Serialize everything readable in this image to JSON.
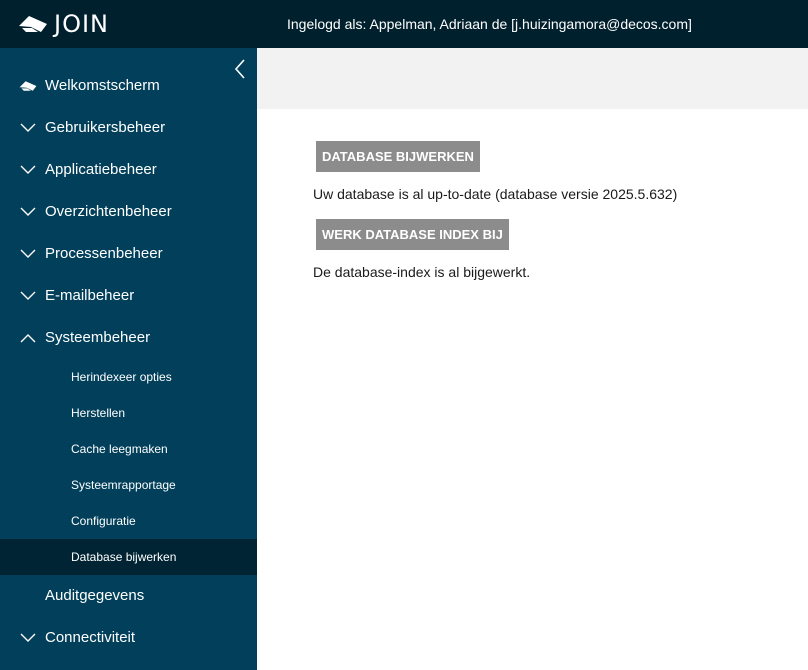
{
  "app": {
    "brand_name": "JOIN",
    "logged_in_text": "Ingelogd als: Appelman, Adriaan de [j.huizingamora@decos.com]"
  },
  "sidebar": {
    "items": [
      {
        "label": "Welkomstscherm",
        "icon": "join-logo-icon"
      },
      {
        "label": "Gebruikersbeheer",
        "icon": "chevron-down-icon"
      },
      {
        "label": "Applicatiebeheer",
        "icon": "chevron-down-icon"
      },
      {
        "label": "Overzichtenbeheer",
        "icon": "chevron-down-icon"
      },
      {
        "label": "Processenbeheer",
        "icon": "chevron-down-icon"
      },
      {
        "label": "E-mailbeheer",
        "icon": "chevron-down-icon"
      },
      {
        "label": "Systeembeheer",
        "icon": "chevron-up-icon",
        "expanded": true
      },
      {
        "label": "Auditgegevens"
      },
      {
        "label": "Connectiviteit",
        "icon": "chevron-down-icon"
      }
    ],
    "sub_items": [
      {
        "label": "Herindexeer opties"
      },
      {
        "label": "Herstellen"
      },
      {
        "label": "Cache leegmaken"
      },
      {
        "label": "Systeemrapportage"
      },
      {
        "label": "Configuratie"
      },
      {
        "label": "Database bijwerken",
        "active": true
      }
    ]
  },
  "main": {
    "update_button_label": "DATABASE BIJWERKEN",
    "update_status_text": "Uw database is al up-to-date (database versie 2025.5.632)",
    "index_button_label": "WERK DATABASE INDEX BIJ",
    "index_status_text": "De database-index is al bijgewerkt."
  },
  "colors": {
    "topbar_bg": "#01202e",
    "sidebar_bg": "#013f5a",
    "active_item_bg": "#002433",
    "button_bg": "#8c8c8c",
    "header_strip_bg": "#f2f2f2"
  }
}
